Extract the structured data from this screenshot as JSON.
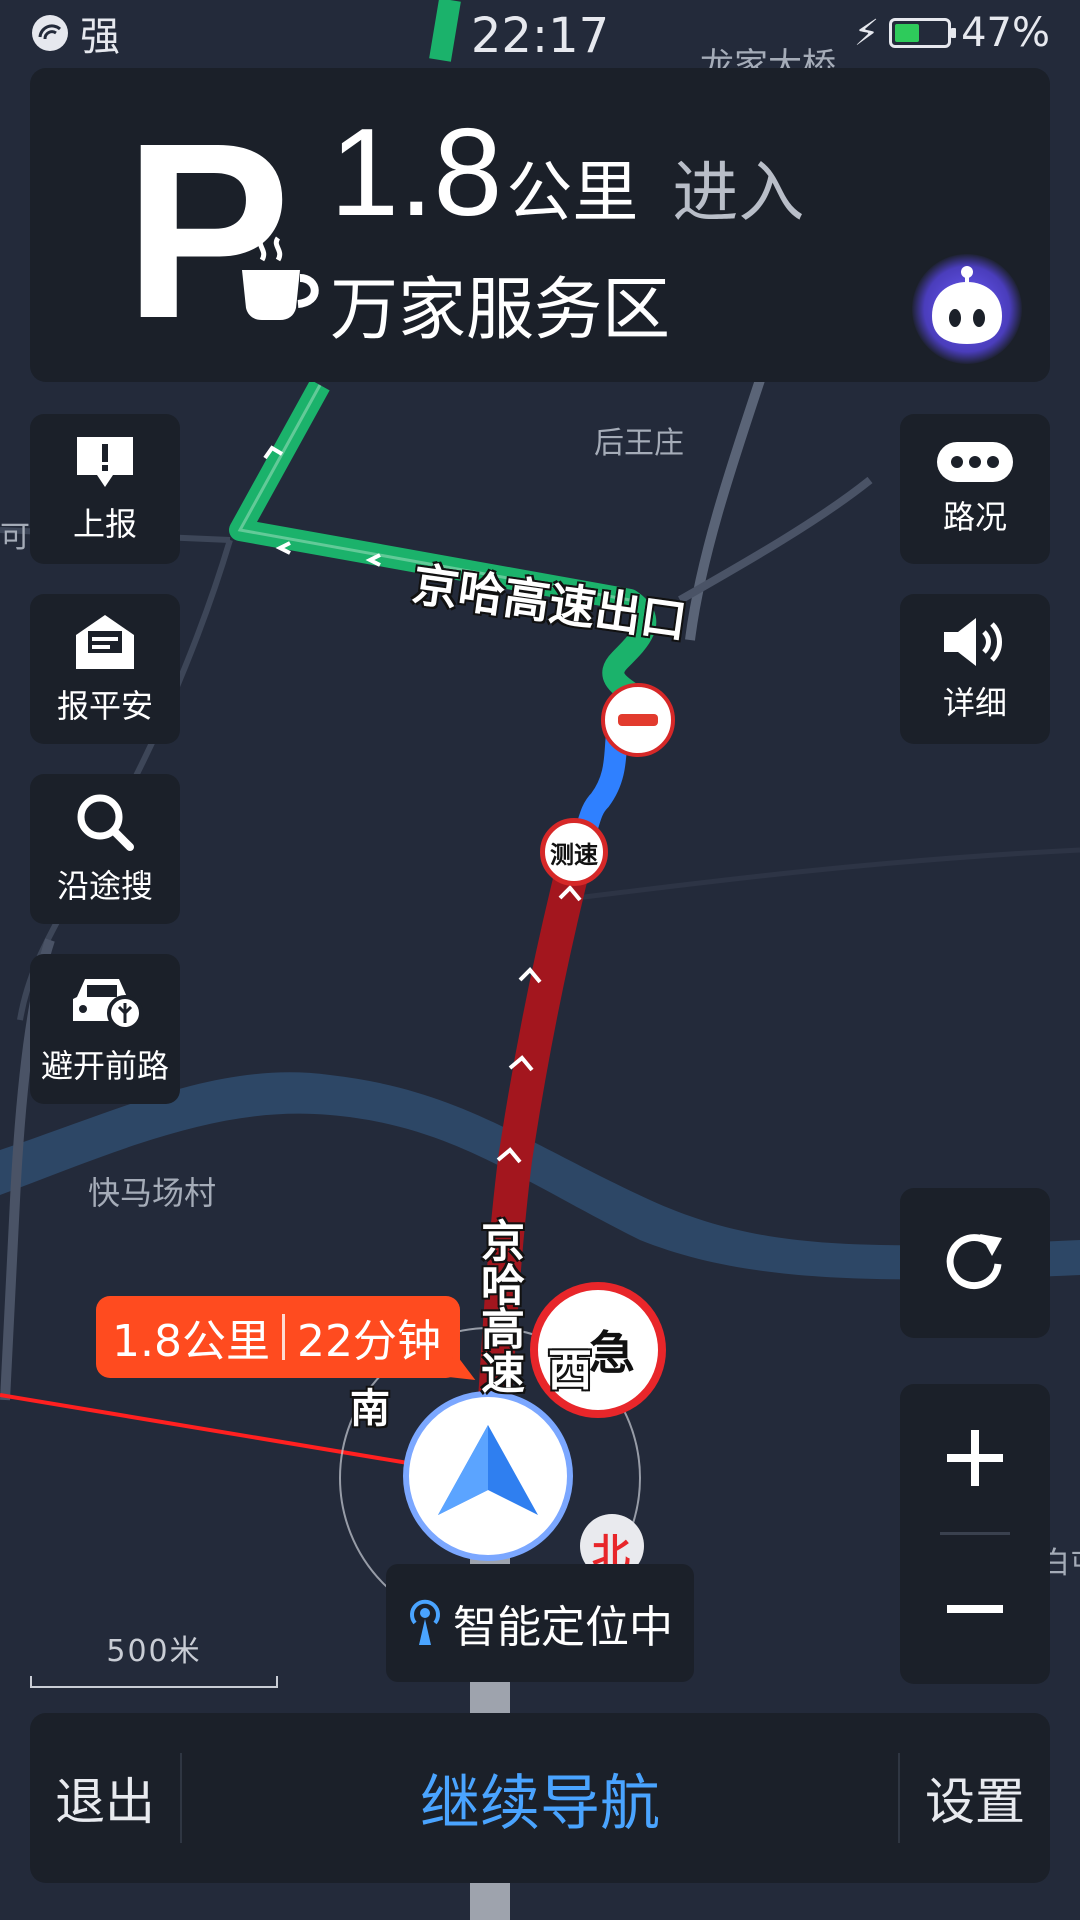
{
  "status_bar": {
    "signal": "强",
    "time": "22:17",
    "battery_percent": "47%",
    "battery_level": 0.47
  },
  "guidance": {
    "distance_value": "1.8",
    "distance_unit": "公里",
    "action": "进入",
    "destination": "万家服务区",
    "icon": "parking-with-coffee-icon"
  },
  "map": {
    "labels": {
      "top_left": "…",
      "top_right": "龙家大桥",
      "village_1": "后王庄",
      "left_cut": "可",
      "village_2": "快马场村",
      "right_cut": "白屯",
      "scale": "500米"
    },
    "road_labels": {
      "exit": "京哈高速出口",
      "highway": "京哈高速"
    },
    "markers": {
      "speed_camera": "测速",
      "emergency": "急",
      "dir_south": "南",
      "dir_west": "西",
      "dir_north": "北"
    },
    "eta": {
      "distance": "1.8公里",
      "duration": "22分钟"
    },
    "locating_text": "智能定位中"
  },
  "left_buttons": [
    {
      "label": "上报",
      "icon": "report-icon"
    },
    {
      "label": "报平安",
      "icon": "safe-mail-icon"
    },
    {
      "label": "沿途搜",
      "icon": "search-icon"
    },
    {
      "label": "避开前路",
      "icon": "avoid-road-car-icon"
    }
  ],
  "right_buttons": [
    {
      "label": "路况",
      "icon": "traffic-icon"
    },
    {
      "label": "详细",
      "icon": "speaker-icon"
    }
  ],
  "bottom_bar": {
    "exit": "退出",
    "continue": "继续导航",
    "settings": "设置"
  },
  "colors": {
    "accent": "#4aa4ff",
    "route_green": "#1bb26b",
    "route_red": "#a3161e",
    "eta_orange": "#ff4b1f"
  }
}
